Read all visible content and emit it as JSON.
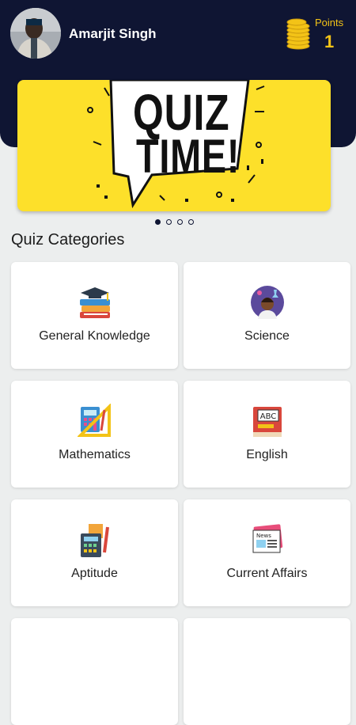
{
  "user": {
    "name": "Amarjit Singh"
  },
  "points": {
    "label": "Points",
    "value": "1"
  },
  "banner": {
    "line1": "QUIZ",
    "line2": "TIME!"
  },
  "section_title": "Quiz Categories",
  "categories": [
    {
      "label": "General Knowledge",
      "icon": "books-graduation-cap-icon"
    },
    {
      "label": "Science",
      "icon": "scientist-icon"
    },
    {
      "label": "Mathematics",
      "icon": "calculator-ruler-icon"
    },
    {
      "label": "English",
      "icon": "abc-book-icon"
    },
    {
      "label": "Aptitude",
      "icon": "calculator-pencil-icon"
    },
    {
      "label": "Current Affairs",
      "icon": "newspaper-icon"
    }
  ],
  "colors": {
    "header": "#0f1533",
    "accent": "#f3c317",
    "banner": "#fde02a",
    "background": "#eceeee"
  }
}
